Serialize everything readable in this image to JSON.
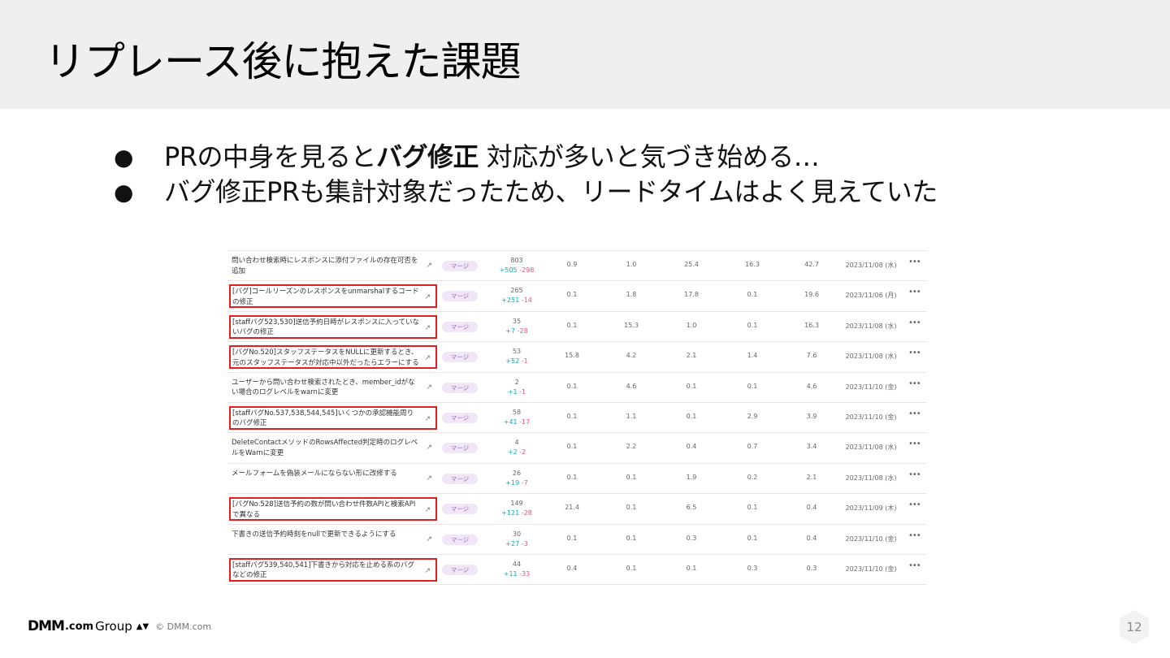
{
  "slide": {
    "title": "リプレース後に抱えた課題",
    "bullets": [
      {
        "before": "PRの中身を見ると",
        "bold": "バグ修正",
        "after": " 対応が多いと気づき始める…"
      },
      {
        "before": "バグ修正PRも集計対象だったため、リードタイムはよく見えていた",
        "bold": "",
        "after": ""
      }
    ],
    "bullet_glyph": "●"
  },
  "pr_table": {
    "rows": [
      {
        "title": "問い合わせ検索時にレスポンスに添付ファイルの存在可否を追加",
        "highlighted": false,
        "status": "マージ",
        "total": "803",
        "add": "+505",
        "del": "-298",
        "c1": "0.9",
        "c2": "1.0",
        "c3": "25.4",
        "c4": "16.3",
        "c5": "42.7",
        "date": "2023/11/08 (水)"
      },
      {
        "title": "[バグ]コールリーズンのレスポンスをunmarshalするコードの修正",
        "highlighted": true,
        "status": "マージ",
        "total": "265",
        "add": "+251",
        "del": "-14",
        "c1": "0.1",
        "c2": "1.8",
        "c3": "17.8",
        "c4": "0.1",
        "c5": "19.6",
        "date": "2023/11/06 (月)"
      },
      {
        "title": "[staffバグ523,530]送信予約日時がレスポンスに入っていないバグの修正",
        "highlighted": true,
        "status": "マージ",
        "total": "35",
        "add": "+7",
        "del": "-28",
        "c1": "0.1",
        "c2": "15.3",
        "c3": "1.0",
        "c4": "0.1",
        "c5": "16.3",
        "date": "2023/11/08 (水)"
      },
      {
        "title": "[バグNo.520]スタッフステータスをNULLに更新するとき、元のスタッフステータスが対応中以外だったらエラーにする",
        "highlighted": true,
        "status": "マージ",
        "total": "53",
        "add": "+52",
        "del": "-1",
        "c1": "15.8",
        "c2": "4.2",
        "c3": "2.1",
        "c4": "1.4",
        "c5": "7.6",
        "date": "2023/11/08 (水)"
      },
      {
        "title": "ユーザーから問い合わせ検索されたとき、member_idがない場合のログレベルをwarnに変更",
        "highlighted": false,
        "status": "マージ",
        "total": "2",
        "add": "+1",
        "del": "-1",
        "c1": "0.1",
        "c2": "4.6",
        "c3": "0.1",
        "c4": "0.1",
        "c5": "4.6",
        "date": "2023/11/10 (金)"
      },
      {
        "title": "[staffバグNo.537,538,544,545]いくつかの承認機能周りのバグ修正",
        "highlighted": true,
        "status": "マージ",
        "total": "58",
        "add": "+41",
        "del": "-17",
        "c1": "0.1",
        "c2": "1.1",
        "c3": "0.1",
        "c4": "2.9",
        "c5": "3.9",
        "date": "2023/11/10 (金)"
      },
      {
        "title": "DeleteContactメソッドのRowsAffected判定時のログレベルをWarnに変更",
        "highlighted": false,
        "status": "マージ",
        "total": "4",
        "add": "+2",
        "del": "-2",
        "c1": "0.1",
        "c2": "2.2",
        "c3": "0.4",
        "c4": "0.7",
        "c5": "3.4",
        "date": "2023/11/08 (水)"
      },
      {
        "title": "メールフォームを偽装メールにならない形に改修する",
        "highlighted": false,
        "status": "マージ",
        "total": "26",
        "add": "+19",
        "del": "-7",
        "c1": "0.1",
        "c2": "0.1",
        "c3": "1.9",
        "c4": "0.2",
        "c5": "2.1",
        "date": "2023/11/08 (水)"
      },
      {
        "title": "[バグNo.528]送信予約の数が問い合わせ件数APIと検索APIで異なる",
        "highlighted": true,
        "status": "マージ",
        "total": "149",
        "add": "+121",
        "del": "-28",
        "c1": "21.4",
        "c2": "0.1",
        "c3": "6.5",
        "c4": "0.1",
        "c5": "0.4",
        "date": "2023/11/09 (木)"
      },
      {
        "title": "下書きの送信予約時刻をnullで更新できるようにする",
        "highlighted": false,
        "status": "マージ",
        "total": "30",
        "add": "+27",
        "del": "-3",
        "c1": "0.1",
        "c2": "0.1",
        "c3": "0.3",
        "c4": "0.1",
        "c5": "0.4",
        "date": "2023/11/10 (金)"
      },
      {
        "title": "[staffバグ539,540,541]下書きから対応を止める系のバグなどの修正",
        "highlighted": true,
        "status": "マージ",
        "total": "44",
        "add": "+11",
        "del": "-33",
        "c1": "0.4",
        "c2": "0.1",
        "c3": "0.1",
        "c4": "0.3",
        "c5": "0.3",
        "date": "2023/11/10 (金)"
      }
    ],
    "link_icon": "external-link-icon",
    "more_glyph": "•••",
    "highlight_color": "#e02020",
    "add_color": "#17a8b8",
    "del_color": "#e0557a"
  },
  "footer": {
    "logo_dmm": "DMM",
    "logo_dotcom": ".com",
    "logo_group": "Group",
    "logo_mark": "▲▼",
    "copyright": "© DMM.com",
    "page_number": "12"
  }
}
